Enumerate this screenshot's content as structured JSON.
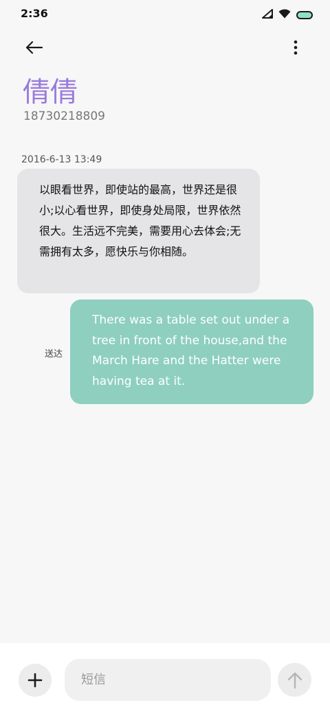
{
  "status_bar": {
    "time": "2:36",
    "icons": [
      "cellular-signal-icon",
      "wifi-icon",
      "battery-icon"
    ],
    "battery_color": "#8fe0c8"
  },
  "header": {
    "back_icon": "arrow-left-icon",
    "more_icon": "more-vertical-icon",
    "contact_name": "倩倩",
    "contact_number": "18730218809"
  },
  "conversation": {
    "timestamp": "2016-6-13 13:49",
    "incoming_message": "以眼看世界，即使站的最高，世界还是很小;以心看世界，即使身处局限，世界依然很大。生活远不完美，需要用心去体会;无需拥有太多，愿快乐与你相随。",
    "outgoing_message": "There was a table set out under a tree in front of the house,and the March Hare and the Hatter were having tea at it.",
    "outgoing_status": "送达"
  },
  "composer": {
    "placeholder": "短信",
    "add_icon": "plus-icon",
    "send_icon": "arrow-up-icon"
  },
  "colors": {
    "name_accent": "#9a7bdc",
    "incoming_bubble": "#e5e5e7",
    "outgoing_bubble": "#8ecfc0",
    "background": "#f7f7f7"
  }
}
